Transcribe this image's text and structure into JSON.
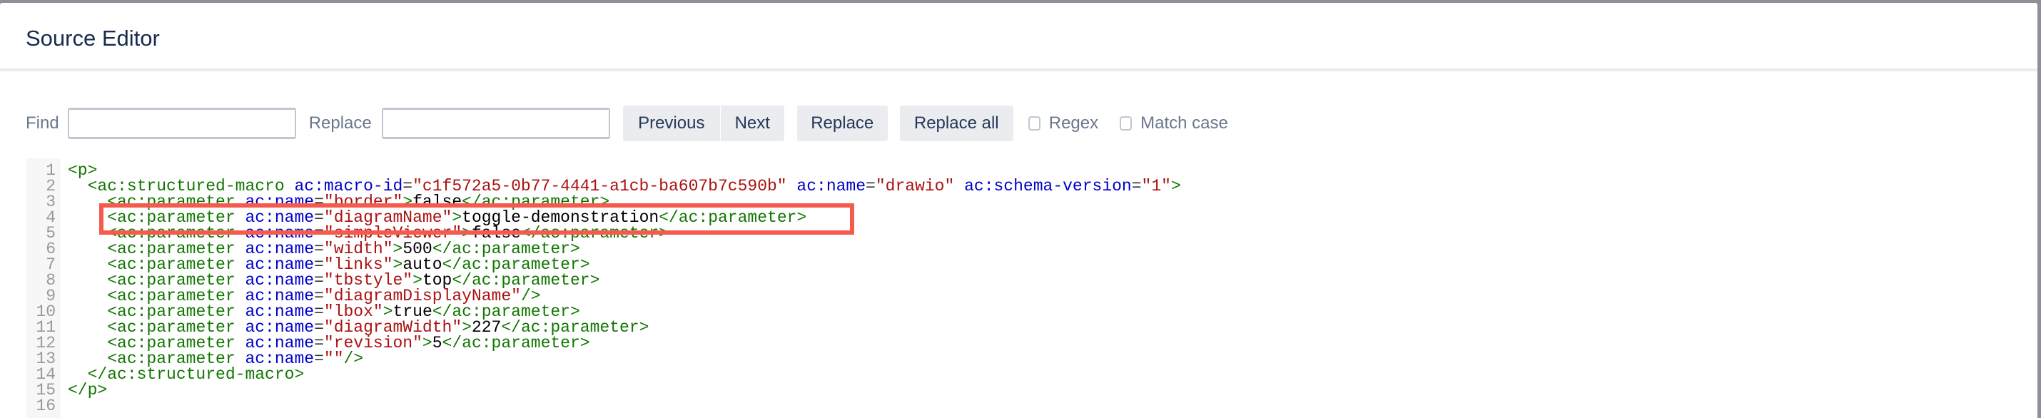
{
  "dialog": {
    "title": "Source Editor"
  },
  "toolbar": {
    "find_label": "Find",
    "find_value": "",
    "replace_label": "Replace",
    "replace_value": "",
    "previous_label": "Previous",
    "next_label": "Next",
    "replace_button": "Replace",
    "replace_all_button": "Replace all",
    "regex_label": "Regex",
    "regex_checked": false,
    "match_case_label": "Match case",
    "match_case_checked": false
  },
  "highlight": {
    "line": 4,
    "color": "#f55a4e"
  },
  "code_lines": [
    [
      [
        "t",
        "<p>"
      ]
    ],
    [
      [
        "x",
        "  "
      ],
      [
        "t",
        "<ac:structured-macro "
      ],
      [
        "a",
        "ac:macro-id"
      ],
      [
        "e",
        "="
      ],
      [
        "s",
        "\"c1f572a5-0b77-4441-a1cb-ba607b7c590b\""
      ],
      [
        "x",
        " "
      ],
      [
        "a",
        "ac:name"
      ],
      [
        "e",
        "="
      ],
      [
        "s",
        "\"drawio\""
      ],
      [
        "x",
        " "
      ],
      [
        "a",
        "ac:schema-version"
      ],
      [
        "e",
        "="
      ],
      [
        "s",
        "\"1\""
      ],
      [
        "t",
        ">"
      ]
    ],
    [
      [
        "x",
        "    "
      ],
      [
        "t",
        "<ac:parameter "
      ],
      [
        "a",
        "ac:name"
      ],
      [
        "e",
        "="
      ],
      [
        "s",
        "\"border\""
      ],
      [
        "t",
        ">"
      ],
      [
        "x",
        "false"
      ],
      [
        "t",
        "</ac:parameter>"
      ]
    ],
    [
      [
        "x",
        "    "
      ],
      [
        "t",
        "<ac:parameter "
      ],
      [
        "a",
        "ac:name"
      ],
      [
        "e",
        "="
      ],
      [
        "s",
        "\"diagramName\""
      ],
      [
        "t",
        ">"
      ],
      [
        "x",
        "toggle-demonstration"
      ],
      [
        "t",
        "</ac:parameter>"
      ]
    ],
    [
      [
        "x",
        "    "
      ],
      [
        "t",
        "<ac:parameter "
      ],
      [
        "a",
        "ac:name"
      ],
      [
        "e",
        "="
      ],
      [
        "s",
        "\"simpleViewer\""
      ],
      [
        "t",
        ">"
      ],
      [
        "x",
        "false"
      ],
      [
        "t",
        "</ac:parameter>"
      ]
    ],
    [
      [
        "x",
        "    "
      ],
      [
        "t",
        "<ac:parameter "
      ],
      [
        "a",
        "ac:name"
      ],
      [
        "e",
        "="
      ],
      [
        "s",
        "\"width\""
      ],
      [
        "t",
        ">"
      ],
      [
        "x",
        "500"
      ],
      [
        "t",
        "</ac:parameter>"
      ]
    ],
    [
      [
        "x",
        "    "
      ],
      [
        "t",
        "<ac:parameter "
      ],
      [
        "a",
        "ac:name"
      ],
      [
        "e",
        "="
      ],
      [
        "s",
        "\"links\""
      ],
      [
        "t",
        ">"
      ],
      [
        "x",
        "auto"
      ],
      [
        "t",
        "</ac:parameter>"
      ]
    ],
    [
      [
        "x",
        "    "
      ],
      [
        "t",
        "<ac:parameter "
      ],
      [
        "a",
        "ac:name"
      ],
      [
        "e",
        "="
      ],
      [
        "s",
        "\"tbstyle\""
      ],
      [
        "t",
        ">"
      ],
      [
        "x",
        "top"
      ],
      [
        "t",
        "</ac:parameter>"
      ]
    ],
    [
      [
        "x",
        "    "
      ],
      [
        "t",
        "<ac:parameter "
      ],
      [
        "a",
        "ac:name"
      ],
      [
        "e",
        "="
      ],
      [
        "s",
        "\"diagramDisplayName\""
      ],
      [
        "t",
        "/>"
      ]
    ],
    [
      [
        "x",
        "    "
      ],
      [
        "t",
        "<ac:parameter "
      ],
      [
        "a",
        "ac:name"
      ],
      [
        "e",
        "="
      ],
      [
        "s",
        "\"lbox\""
      ],
      [
        "t",
        ">"
      ],
      [
        "x",
        "true"
      ],
      [
        "t",
        "</ac:parameter>"
      ]
    ],
    [
      [
        "x",
        "    "
      ],
      [
        "t",
        "<ac:parameter "
      ],
      [
        "a",
        "ac:name"
      ],
      [
        "e",
        "="
      ],
      [
        "s",
        "\"diagramWidth\""
      ],
      [
        "t",
        ">"
      ],
      [
        "x",
        "227"
      ],
      [
        "t",
        "</ac:parameter>"
      ]
    ],
    [
      [
        "x",
        "    "
      ],
      [
        "t",
        "<ac:parameter "
      ],
      [
        "a",
        "ac:name"
      ],
      [
        "e",
        "="
      ],
      [
        "s",
        "\"revision\""
      ],
      [
        "t",
        ">"
      ],
      [
        "x",
        "5"
      ],
      [
        "t",
        "</ac:parameter>"
      ]
    ],
    [
      [
        "x",
        "    "
      ],
      [
        "t",
        "<ac:parameter "
      ],
      [
        "a",
        "ac:name"
      ],
      [
        "e",
        "="
      ],
      [
        "s",
        "\"\""
      ],
      [
        "t",
        "/>"
      ]
    ],
    [
      [
        "x",
        "  "
      ],
      [
        "t",
        "</ac:structured-macro>"
      ]
    ],
    [
      [
        "t",
        "</p>"
      ]
    ],
    []
  ]
}
